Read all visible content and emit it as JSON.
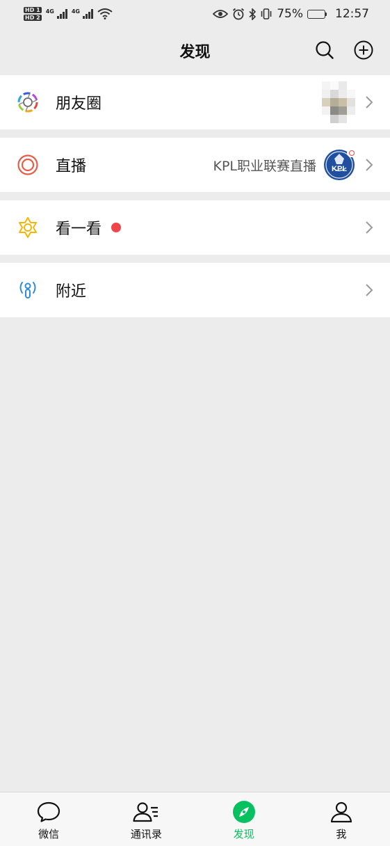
{
  "status_bar": {
    "hd1": "HD 1",
    "hd2": "HD 2",
    "net1": "4G",
    "net2": "4G",
    "battery": "75%",
    "battery_level": 0.75,
    "time": "12:57"
  },
  "header": {
    "title": "发现",
    "search_icon": "search-icon",
    "add_icon": "plus-circle-icon"
  },
  "menu": {
    "moments": {
      "label": "朋友圈",
      "icon": "aperture-icon"
    },
    "live": {
      "label": "直播",
      "sub_text": "KPL职业联赛直播",
      "icon": "live-ring-icon",
      "avatar_text": "KPL"
    },
    "top_stories": {
      "label": "看一看",
      "icon": "star-hexagon-icon",
      "has_dot": true
    },
    "nearby": {
      "label": "附近",
      "icon": "person-signal-icon"
    }
  },
  "colors": {
    "accent": "#07c160",
    "red_dot": "#f0454a",
    "live_icon": "#e65c45",
    "top_stories_icon": "#f2b705",
    "nearby_icon": "#2f8ae0",
    "background": "#ececec"
  },
  "tabs": [
    {
      "label": "微信",
      "icon": "chat-bubble-icon",
      "active": false
    },
    {
      "label": "通讯录",
      "icon": "contacts-icon",
      "active": false
    },
    {
      "label": "发现",
      "icon": "compass-icon",
      "active": true
    },
    {
      "label": "我",
      "icon": "person-icon",
      "active": false
    }
  ]
}
